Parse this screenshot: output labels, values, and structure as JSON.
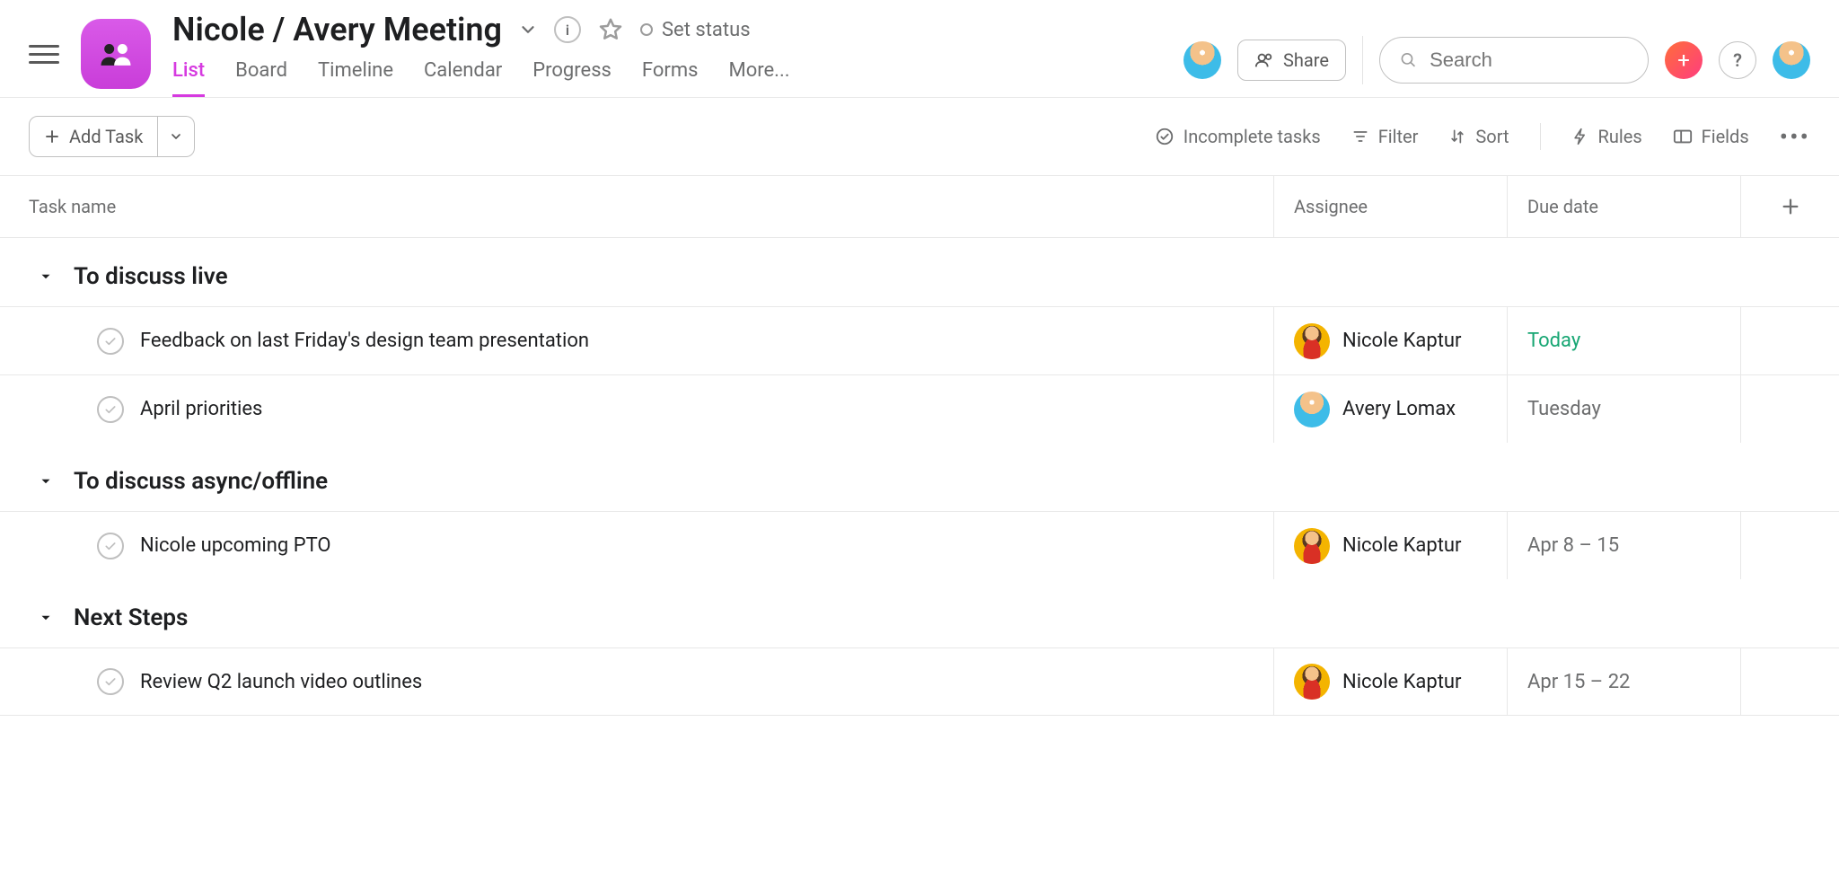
{
  "header": {
    "title": "Nicole / Avery Meeting",
    "set_status": "Set status",
    "share_label": "Share",
    "search_placeholder": "Search",
    "help_label": "?"
  },
  "tabs": [
    {
      "label": "List",
      "active": true
    },
    {
      "label": "Board",
      "active": false
    },
    {
      "label": "Timeline",
      "active": false
    },
    {
      "label": "Calendar",
      "active": false
    },
    {
      "label": "Progress",
      "active": false
    },
    {
      "label": "Forms",
      "active": false
    },
    {
      "label": "More...",
      "active": false
    }
  ],
  "toolbar": {
    "add_task": "Add Task",
    "incomplete": "Incomplete tasks",
    "filter": "Filter",
    "sort": "Sort",
    "rules": "Rules",
    "fields": "Fields"
  },
  "columns": {
    "task_name": "Task name",
    "assignee": "Assignee",
    "due_date": "Due date"
  },
  "sections": [
    {
      "title": "To discuss live",
      "tasks": [
        {
          "name": "Feedback on last Friday's design team presentation",
          "assignee": "Nicole Kaptur",
          "assignee_key": "nicole",
          "due": "Today",
          "due_class": "due-green"
        },
        {
          "name": "April priorities",
          "assignee": "Avery Lomax",
          "assignee_key": "avery",
          "due": "Tuesday",
          "due_class": "due-gray"
        }
      ]
    },
    {
      "title": "To discuss async/offline",
      "tasks": [
        {
          "name": "Nicole upcoming PTO",
          "assignee": "Nicole Kaptur",
          "assignee_key": "nicole",
          "due": "Apr 8 – 15",
          "due_class": "due-gray"
        }
      ]
    },
    {
      "title": "Next Steps",
      "tasks": [
        {
          "name": "Review Q2 launch video outlines",
          "assignee": "Nicole Kaptur",
          "assignee_key": "nicole",
          "due": "Apr 15 – 22",
          "due_class": "due-gray"
        }
      ]
    }
  ]
}
